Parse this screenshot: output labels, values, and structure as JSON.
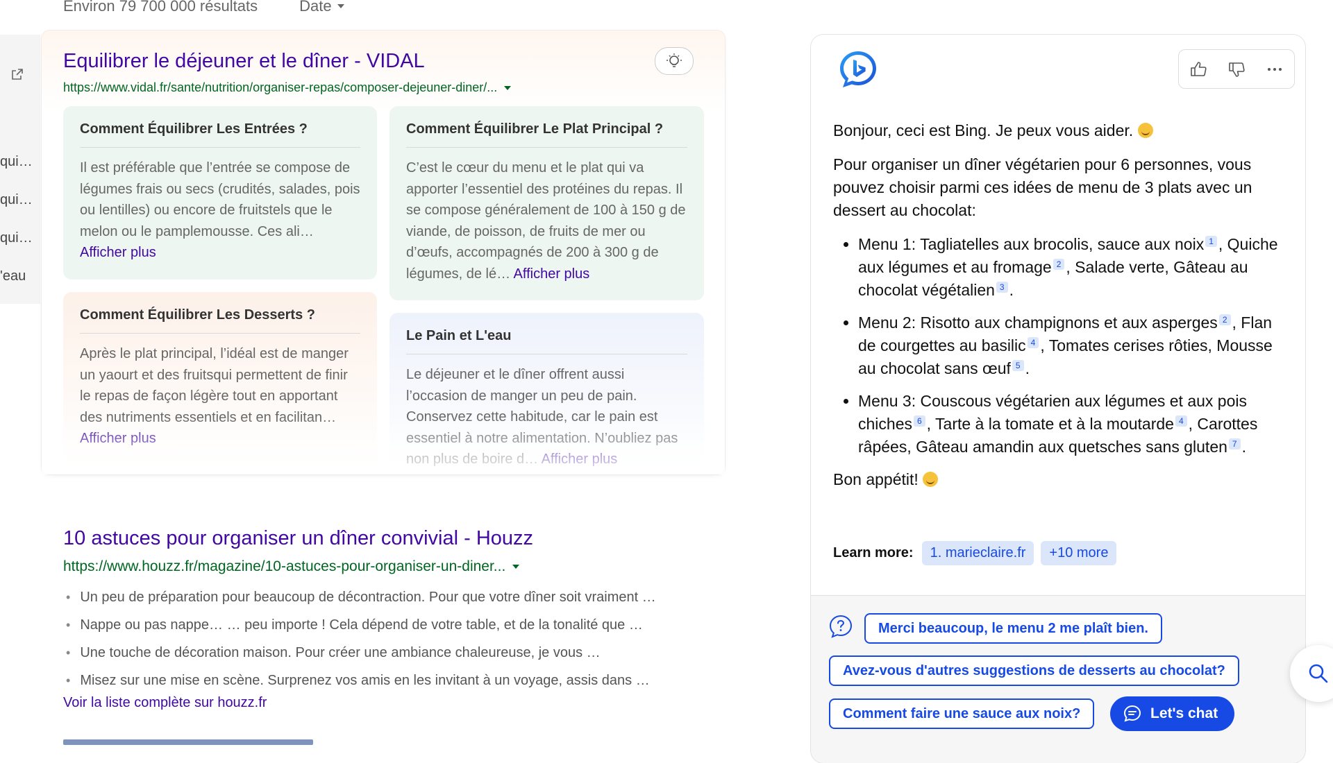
{
  "topbar": {
    "results": "Environ 79 700 000 résultats",
    "date_filter": "Date"
  },
  "sidebar": {
    "items": [
      "qui…",
      "qui…",
      "qui…",
      "'eau"
    ]
  },
  "result1": {
    "title": "Equilibrer le déjeuner et le dîner - VIDAL",
    "url": "https://www.vidal.fr/sante/nutrition/organiser-repas/composer-dejeuner-diner/...",
    "cards": [
      {
        "title": "Comment Équilibrer Les Entrées ?",
        "text": "Il est préférable que l’entrée se compose de légumes frais ou secs (crudités, salades, pois ou lentilles) ou encore de fruitstels que le melon ou le pamplemousse. Ces ali… ",
        "more": "Afficher plus"
      },
      {
        "title": "Comment Équilibrer Le Plat Principal ?",
        "text": "C’est le cœur du menu et le plat qui va apporter l’essentiel des protéines du repas. Il se compose généralement de 100 à 150 g de viande, de poisson, de fruits de mer ou d’œufs, accompagnés de 200 à 300 g de légumes, de lé… ",
        "more": "Afficher plus"
      },
      {
        "title": "Comment Équilibrer Les Desserts ?",
        "text": "Après le plat principal, l’idéal est de manger un yaourt et des fruitsqui permettent de finir le repas de façon légère tout en apportant des nutriments essentiels et en facilitan… ",
        "more": "Afficher plus"
      },
      {
        "title": "Le Pain et L'eau",
        "text": "Le déjeuner et le dîner offrent aussi l’occasion de manger un peu de pain. Conservez cette habitude, car le pain est essentiel à notre alimentation. N’oubliez pas non plus de boire d… ",
        "more": "Afficher plus"
      }
    ]
  },
  "result2": {
    "title": "10 astuces pour organiser un dîner convivial - Houzz",
    "url": "https://www.houzz.fr/magazine/10-astuces-pour-organiser-un-diner...",
    "bullets": [
      "Un peu de préparation pour beaucoup de décontraction. Pour que votre dîner soit vraiment …",
      "Nappe ou pas nappe… … peu importe ! Cela dépend de votre table, et de la tonalité que …",
      "Une touche de décoration maison. Pour créer une ambiance chaleureuse, je vous …",
      "Misez sur une mise en scène. Surprenez vos amis en les invitant à un voyage, assis dans …"
    ],
    "more_link": "Voir la liste complète sur houzz.fr"
  },
  "chat": {
    "greeting": "Bonjour, ceci est Bing. Je peux vous aider.",
    "intro": "Pour organiser un dîner végétarien pour 6 personnes, vous pouvez choisir parmi ces idées de menu de 3 plats avec un dessert au chocolat:",
    "menus": [
      {
        "a": "Menu 1: Tagliatelles aux brocolis, sauce aux noix",
        "c1": "1",
        "b": ", Quiche aux légumes et au fromage",
        "c2": "2",
        "d": ", Salade verte, Gâteau au chocolat végétalien",
        "c3": "3",
        "end": "."
      },
      {
        "a": "Menu 2: Risotto aux champignons et aux asperges",
        "c1": "2",
        "b": ", Flan de courgettes au basilic",
        "c2": "4",
        "d": ", Tomates cerises rôties, Mousse au chocolat sans œuf",
        "c3": "5",
        "end": "."
      },
      {
        "a": "Menu 3: Couscous végétarien aux légumes et aux pois chiches",
        "c1": "6",
        "b": ", Tarte à la tomate et à la moutarde",
        "c2": "4",
        "d": ", Carottes râpées, Gâteau amandin aux quetsches sans gluten",
        "c3": "7",
        "end": "."
      }
    ],
    "closing": "Bon appétit!",
    "learn_more_label": "Learn more:",
    "learn_more_chips": [
      "1. marieclaire.fr",
      "+10 more"
    ],
    "suggestions": [
      "Merci beaucoup, le menu 2 me plaît bien.",
      "Avez-vous d'autres suggestions de desserts au chocolat?",
      "Comment faire une sauce aux noix?"
    ],
    "lets_chat": "Let's chat"
  },
  "colors": {
    "link": "#4007a2",
    "url_green": "#006621",
    "bing_blue": "#174ae4"
  }
}
